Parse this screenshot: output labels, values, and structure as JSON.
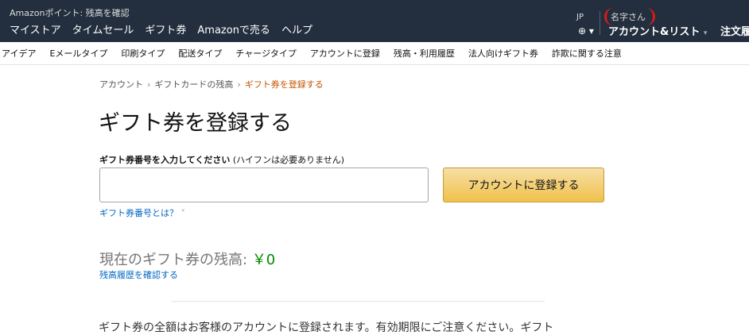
{
  "header": {
    "points_text": "Amazonポイント: 残高を確認",
    "nav_links": [
      "マイストア",
      "タイムセール",
      "ギフト券",
      "Amazonで売る",
      "ヘルプ"
    ],
    "lang_code": "JP",
    "hello_text": "名字さん",
    "account_label": "アカウント&リスト",
    "orders_label": "注文履"
  },
  "subnav": [
    "アイデア",
    "Eメールタイプ",
    "印刷タイプ",
    "配送タイプ",
    "チャージタイプ",
    "アカウントに登録",
    "残高・利用履歴",
    "法人向けギフト券",
    "詐欺に関する注意"
  ],
  "breadcrumb": {
    "items": [
      "アカウント",
      "ギフトカードの残高"
    ],
    "current": "ギフト券を登録する"
  },
  "page": {
    "title": "ギフト券を登録する",
    "input_label_bold": "ギフト券番号を入力してください",
    "input_label_note": "(ハイフンは必要ありません)",
    "input_value": "",
    "submit_label": "アカウントに登録する",
    "what_is_link": "ギフト券番号とは？",
    "balance_label": "現在のギフト券の残高:",
    "balance_amount": "￥0",
    "history_link": "残高履歴を確認する",
    "notice": "ギフト券の全額はお客様のアカウントに登録されます。有効期限にご注意ください。ギフト"
  },
  "colors": {
    "header_bg": "#232f3e",
    "button_bg": "#f0c14b",
    "link": "#0066c0",
    "breadcrumb_current": "#c45500",
    "balance_amount": "#008a00"
  }
}
